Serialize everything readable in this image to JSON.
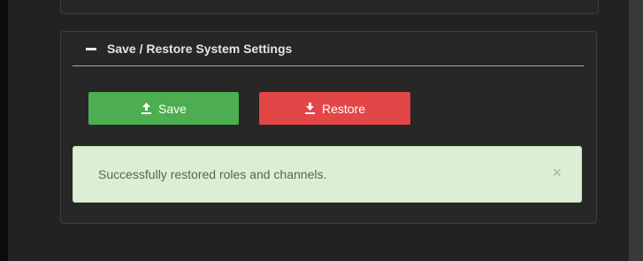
{
  "panel": {
    "title": "Save / Restore System Settings",
    "collapse_icon": "minus-icon"
  },
  "buttons": {
    "save_label": "Save",
    "save_icon": "save-icon",
    "save_color": "#4cae50",
    "restore_label": "Restore",
    "restore_icon": "restore-icon",
    "restore_color": "#e34646"
  },
  "alert": {
    "message": "Successfully restored roles and channels.",
    "close_glyph": "×",
    "background": "#dcefd5",
    "text_color": "#4a7042"
  }
}
